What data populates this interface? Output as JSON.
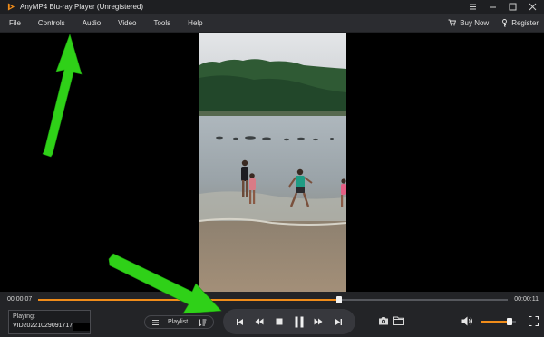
{
  "app": {
    "title": "AnyMP4 Blu-ray Player (Unregistered)"
  },
  "menu": {
    "items": [
      "File",
      "Controls",
      "Audio",
      "Video",
      "Tools",
      "Help"
    ],
    "buy_now": "Buy Now",
    "register": "Register"
  },
  "player": {
    "current_time": "00:00:07",
    "total_time": "00:00:11",
    "progress": 0.64,
    "now_playing_label": "Playing:",
    "file_name": "VID20221029091717",
    "playlist_label": "Playlist",
    "volume": 0.82
  },
  "colors": {
    "accent": "#f08c1a",
    "arrow": "#2fd118"
  }
}
